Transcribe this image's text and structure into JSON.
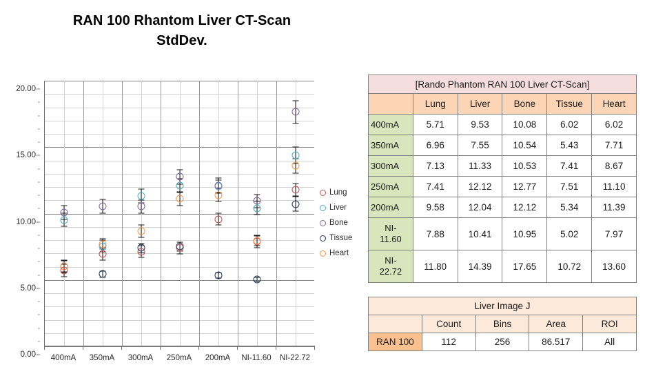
{
  "title": {
    "line1": "RAN 100 Rhantom Liver CT-Scan",
    "line2": "StdDev."
  },
  "chart_data": {
    "type": "scatter",
    "title": "RAN 100 Rhantom Liver CT-Scan StdDev.",
    "xlabel": "",
    "ylabel": "",
    "ylim": [
      0,
      20
    ],
    "yticks": [
      "0.00",
      "5.00",
      "10.00",
      "15.00",
      "20.00"
    ],
    "ytick_values": [
      0,
      5,
      10,
      15,
      20
    ],
    "minor_tick_step": 1,
    "grid": true,
    "legend_position": "right",
    "categories": [
      "400mA",
      "350mA",
      "300mA",
      "250mA",
      "200mA",
      "NI-11.60",
      "NI-22.72"
    ],
    "series": [
      {
        "name": "Lung",
        "color": "#c0504d",
        "values": [
          5.71,
          6.96,
          7.13,
          7.41,
          9.58,
          7.88,
          11.8
        ],
        "errors": [
          0.45,
          0.45,
          0.45,
          0.45,
          0.45,
          0.45,
          0.45
        ]
      },
      {
        "name": "Liver",
        "color": "#4bacc6",
        "values": [
          9.53,
          7.55,
          11.33,
          12.12,
          12.04,
          10.41,
          14.39
        ],
        "errors": [
          0.5,
          0.45,
          0.5,
          0.5,
          0.5,
          0.5,
          0.6
        ]
      },
      {
        "name": "Bone",
        "color": "#8064a2",
        "values": [
          10.08,
          10.54,
          10.53,
          12.77,
          12.12,
          10.95,
          17.65
        ],
        "errors": [
          0.5,
          0.5,
          0.5,
          0.55,
          0.55,
          0.5,
          0.85
        ]
      },
      {
        "name": "Tissue",
        "color": "#1f3864",
        "values": [
          6.02,
          5.43,
          7.41,
          7.51,
          5.34,
          5.02,
          10.72
        ],
        "errors": [
          0.4,
          0.25,
          0.35,
          0.35,
          0.2,
          0.15,
          0.55
        ]
      },
      {
        "name": "Heart",
        "color": "#f79646",
        "values": [
          6.02,
          7.71,
          8.67,
          11.1,
          11.39,
          7.97,
          13.6
        ],
        "errors": [
          0.45,
          0.4,
          0.45,
          0.5,
          0.5,
          0.4,
          0.55
        ]
      }
    ]
  },
  "legend": {
    "items": [
      {
        "label": "Lung",
        "color": "#c0504d"
      },
      {
        "label": "Liver",
        "color": "#4bacc6"
      },
      {
        "label": "Bone",
        "color": "#8064a2"
      },
      {
        "label": "Tissue",
        "color": "#1f3864"
      },
      {
        "label": "Heart",
        "color": "#f79646"
      }
    ]
  },
  "main_table": {
    "title": "[Rando Phantom RAN 100 Liver CT-Scan]",
    "columns": [
      "Lung",
      "Liver",
      "Bone",
      "Tissue",
      "Heart"
    ],
    "rows": [
      {
        "label": "400mA",
        "label2": "",
        "values": [
          "5.71",
          "9.53",
          "10.08",
          "6.02",
          "6.02"
        ]
      },
      {
        "label": "350mA",
        "label2": "",
        "values": [
          "6.96",
          "7.55",
          "10.54",
          "5.43",
          "7.71"
        ]
      },
      {
        "label": "300mA",
        "label2": "",
        "values": [
          "7.13",
          "11.33",
          "10.53",
          "7.41",
          "8.67"
        ]
      },
      {
        "label": "250mA",
        "label2": "",
        "values": [
          "7.41",
          "12.12",
          "12.77",
          "7.51",
          "11.10"
        ]
      },
      {
        "label": "200mA",
        "label2": "",
        "values": [
          "9.58",
          "12.04",
          "12.12",
          "5.34",
          "11.39"
        ]
      },
      {
        "label": "NI-",
        "label2": "11.60",
        "values": [
          "7.88",
          "10.41",
          "10.95",
          "5.02",
          "7.97"
        ]
      },
      {
        "label": "NI-",
        "label2": "22.72",
        "values": [
          "11.80",
          "14.39",
          "17.65",
          "10.72",
          "13.60"
        ]
      }
    ]
  },
  "sub_table": {
    "title": "Liver Image J",
    "columns": [
      "Count",
      "Bins",
      "Area",
      "ROI"
    ],
    "row_label": "RAN 100",
    "values": [
      "112",
      "256",
      "86.517",
      "All"
    ]
  }
}
